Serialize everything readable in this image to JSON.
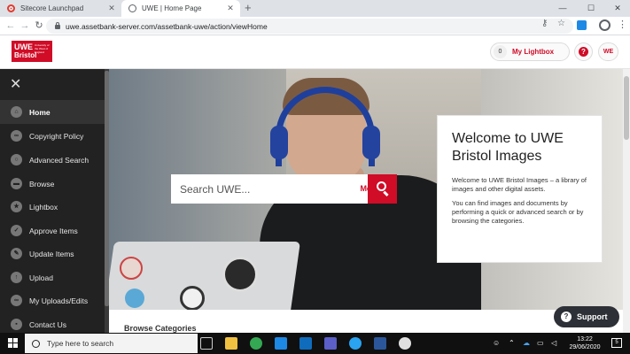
{
  "browser": {
    "tabs": [
      {
        "title": "Sitecore Launchpad"
      },
      {
        "title": "UWE | Home Page"
      }
    ],
    "url": "uwe.assetbank-server.com/assetbank-uwe/action/viewHome"
  },
  "header": {
    "logo": {
      "line1": "UWE",
      "line2": "Bristol",
      "tagline": "University of the West of England"
    },
    "lightbox_count": "0",
    "lightbox_label": "My Lightbox",
    "help_label": "?",
    "user_initials": "WE"
  },
  "sidebar": {
    "items": [
      {
        "label": "Home",
        "icon": "home-icon",
        "glyph": "⌂"
      },
      {
        "label": "Copyright Policy",
        "icon": "link-icon",
        "glyph": "∞"
      },
      {
        "label": "Advanced Search",
        "icon": "search-icon",
        "glyph": "○"
      },
      {
        "label": "Browse",
        "icon": "folder-icon",
        "glyph": "▬"
      },
      {
        "label": "Lightbox",
        "icon": "star-icon",
        "glyph": "★"
      },
      {
        "label": "Approve Items",
        "icon": "check-icon",
        "glyph": "✓"
      },
      {
        "label": "Update Items",
        "icon": "pencil-icon",
        "glyph": "✎"
      },
      {
        "label": "Upload",
        "icon": "upload-icon",
        "glyph": "↑"
      },
      {
        "label": "My Uploads/Edits",
        "icon": "link-icon",
        "glyph": "∞"
      },
      {
        "label": "Contact Us",
        "icon": "chat-icon",
        "glyph": "▪"
      }
    ]
  },
  "hero": {
    "search_placeholder": "Search UWE...",
    "more_label": "More",
    "welcome_title": "Welcome to UWE Bristol Images",
    "welcome_p1": "Welcome to UWE Bristol Images – a library of images and other digital assets.",
    "welcome_p2": "You can find images and documents by performing a quick or advanced search or by browsing the categories."
  },
  "content": {
    "browse_title": "Browse Categories",
    "support_label": "Support"
  },
  "taskbar": {
    "search_placeholder": "Type here to search",
    "time": "13:22",
    "date": "29/06/2020",
    "notifications": "5"
  },
  "colors": {
    "brand_red": "#d00c27",
    "sidebar_bg": "#222222",
    "support_bg": "#2d3036"
  }
}
